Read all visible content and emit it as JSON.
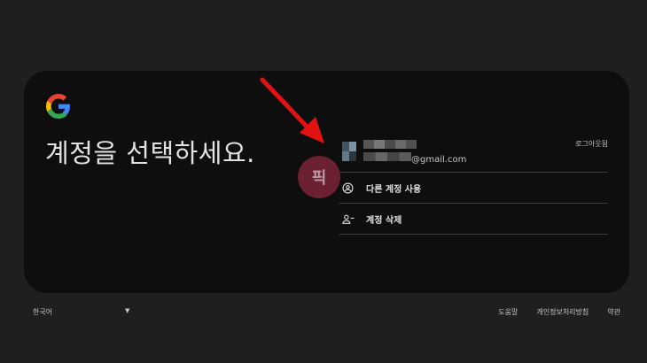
{
  "page": {
    "title": "계정을 선택하세요."
  },
  "account": {
    "email_domain": "@gmail.com",
    "signout_label": "로그아웃됨"
  },
  "actions": [
    {
      "label": "다른 계정 사용",
      "icon": "account-circle-icon"
    },
    {
      "label": "계정 삭제",
      "icon": "person-remove-icon"
    }
  ],
  "watermark": {
    "text": "픽"
  },
  "footer": {
    "language": "한국어",
    "links": [
      "도움말",
      "개인정보처리방침",
      "약관"
    ]
  },
  "colors": {
    "background": "#1f1f1f",
    "card": "#0e0e0e",
    "arrow": "#e31212",
    "google_blue": "#4285f4",
    "google_red": "#ea4335",
    "google_yellow": "#fbbc05",
    "google_green": "#34a853"
  }
}
